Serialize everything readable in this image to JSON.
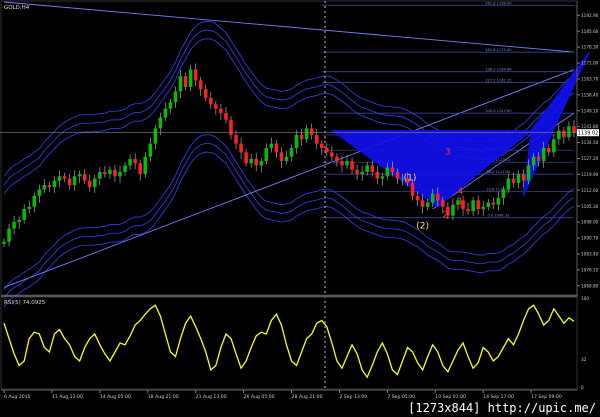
{
  "window": {
    "symbol_label": "GOLD,H4"
  },
  "colors": {
    "background": "#000000",
    "bull_candle": "#00c000",
    "bear_candle": "#ff2020",
    "wick": "#c0c0c0",
    "pattern_fill": "#1010f0",
    "bands": "#3040ff",
    "trendline": "#7080ff",
    "fib_lines": "#4050b0",
    "rsi_line": "#ffff00",
    "wave_label": "#ffe060",
    "red_label": "#ff3030",
    "axis_text": "#d0d0d0"
  },
  "chart_data": [
    {
      "type": "candlestick",
      "panel": "main",
      "y_axis_ticks": [
        "1192.90",
        "1185.60",
        "1178.30",
        "1171.00",
        "1163.70",
        "1156.40",
        "1149.10",
        "1141.80",
        "1134.50",
        "1127.20",
        "1119.90",
        "1112.60",
        "1105.30",
        "1098.00",
        "1090.70",
        "1083.40",
        "1076.10",
        "1068.80"
      ],
      "current_price_label": "1139.02",
      "ylim": [
        1065.0,
        1199.0
      ],
      "x_axis_labels": [
        "6 Aug 2015",
        "11 Aug 13:00",
        "14 Aug 05:00",
        "18 Aug 21:00",
        "21 Aug 13:00",
        "26 Aug 05:00",
        "28 Aug 21:00",
        "2 Sep 13:00",
        "7 Sep 05:00",
        "10 Sep 01:00",
        "14 Sep 17:00",
        "17 Sep 09:00"
      ],
      "x_label_positions": [
        0,
        9.5,
        19,
        28.5,
        38,
        47.5,
        57,
        66.5,
        76,
        85.5,
        95,
        104.5
      ],
      "xlim": [
        0,
        113
      ],
      "close_series": [
        1089,
        1095,
        1098,
        1099,
        1104,
        1105,
        1110,
        1113,
        1115,
        1114,
        1117,
        1119,
        1118,
        1115,
        1119,
        1120,
        1117,
        1114,
        1118,
        1121,
        1120,
        1122,
        1119,
        1121,
        1124,
        1127,
        1125,
        1120,
        1128,
        1134,
        1141,
        1146,
        1150,
        1153,
        1158,
        1165,
        1160,
        1168,
        1163,
        1159,
        1155,
        1152,
        1150,
        1148,
        1145,
        1138,
        1134,
        1130,
        1125,
        1127,
        1124,
        1126,
        1132,
        1134,
        1130,
        1126,
        1128,
        1132,
        1138,
        1136,
        1141,
        1138,
        1134,
        1132,
        1130,
        1128,
        1126,
        1124,
        1126,
        1122,
        1120,
        1121,
        1124,
        1121,
        1118,
        1119,
        1123,
        1121,
        1118,
        1118,
        1116,
        1110,
        1108,
        1105,
        1107,
        1111,
        1108,
        1105,
        1101,
        1106,
        1108,
        1104,
        1103,
        1108,
        1104,
        1105,
        1107,
        1106,
        1109,
        1113,
        1118,
        1116,
        1120,
        1117,
        1124,
        1128,
        1126,
        1132,
        1130,
        1136,
        1140,
        1137,
        1142,
        1139
      ]
    },
    {
      "type": "area",
      "panel": "main",
      "label": "Bearish Gartley pattern",
      "points": [
        [
          65,
          1140
        ],
        [
          86,
          1105
        ],
        [
          104.5,
          1140
        ],
        [
          116,
          1176
        ],
        [
          103,
          1110
        ]
      ]
    },
    {
      "type": "line",
      "panel": "main",
      "label": "fibonacci levels",
      "levels": [
        {
          "label": "261.8 1198.49",
          "value": 1197.5
        },
        {
          "label": "161.8 1175.40",
          "value": 1176.0
        },
        {
          "label": "138.2 1164.86",
          "value": 1167.0
        },
        {
          "label": "127.2 1161.25",
          "value": 1162.0
        },
        {
          "label": "100.0 1147.60",
          "value": 1148.0
        },
        {
          "label": "76.4 1137.78",
          "value": 1138.0
        },
        {
          "label": "61.8 1129.92",
          "value": 1131.0
        },
        {
          "label": "50.0 1123.51",
          "value": 1125.5
        },
        {
          "label": "38.2 1117.40",
          "value": 1120.0
        },
        {
          "label": "23.6 1110.21",
          "value": 1112.0
        },
        {
          "label": "0.0 1096.33",
          "value": 1100.0
        }
      ]
    },
    {
      "type": "line",
      "panel": "main",
      "label": "wave labels",
      "annotations": [
        {
          "text": "(1)",
          "x": 80.5,
          "y": 1117,
          "color": "wave_label"
        },
        {
          "text": "(2)",
          "x": 83,
          "y": 1095,
          "color": "wave_label"
        },
        {
          "text": "1",
          "x": 90.5,
          "y": 1106,
          "color": "red_label"
        },
        {
          "text": "2",
          "x": 87.5,
          "y": 1100,
          "color": "red_label"
        },
        {
          "text": "3",
          "x": 88,
          "y": 1129,
          "color": "red_label"
        },
        {
          "text": "4",
          "x": 90.5,
          "y": 1111,
          "color": "red_label"
        }
      ]
    },
    {
      "type": "line",
      "panel": "rsi",
      "label": "RSI(5) 74.0925",
      "y_axis_ticks": [
        "100",
        "32",
        "0"
      ],
      "ylim": [
        0,
        100
      ],
      "values": [
        72,
        55,
        38,
        25,
        30,
        55,
        62,
        60,
        45,
        40,
        60,
        65,
        55,
        48,
        35,
        30,
        45,
        55,
        60,
        48,
        38,
        30,
        40,
        50,
        48,
        58,
        70,
        75,
        82,
        88,
        92,
        80,
        60,
        40,
        35,
        55,
        72,
        80,
        68,
        55,
        40,
        20,
        25,
        45,
        60,
        55,
        38,
        22,
        30,
        45,
        58,
        62,
        60,
        75,
        82,
        70,
        48,
        30,
        25,
        40,
        55,
        60,
        72,
        75,
        68,
        50,
        30,
        22,
        35,
        48,
        38,
        20,
        12,
        25,
        40,
        50,
        38,
        20,
        15,
        30,
        45,
        40,
        28,
        20,
        35,
        48,
        40,
        25,
        18,
        30,
        42,
        50,
        35,
        22,
        28,
        45,
        40,
        30,
        35,
        45,
        55,
        48,
        60,
        75,
        88,
        92,
        82,
        70,
        75,
        88,
        80,
        72,
        78,
        74
      ]
    }
  ],
  "rsi_panel": {
    "label": "RSI(5) 74.0925"
  },
  "watermark": {
    "text": "[1273x844] http://upic.me/"
  }
}
